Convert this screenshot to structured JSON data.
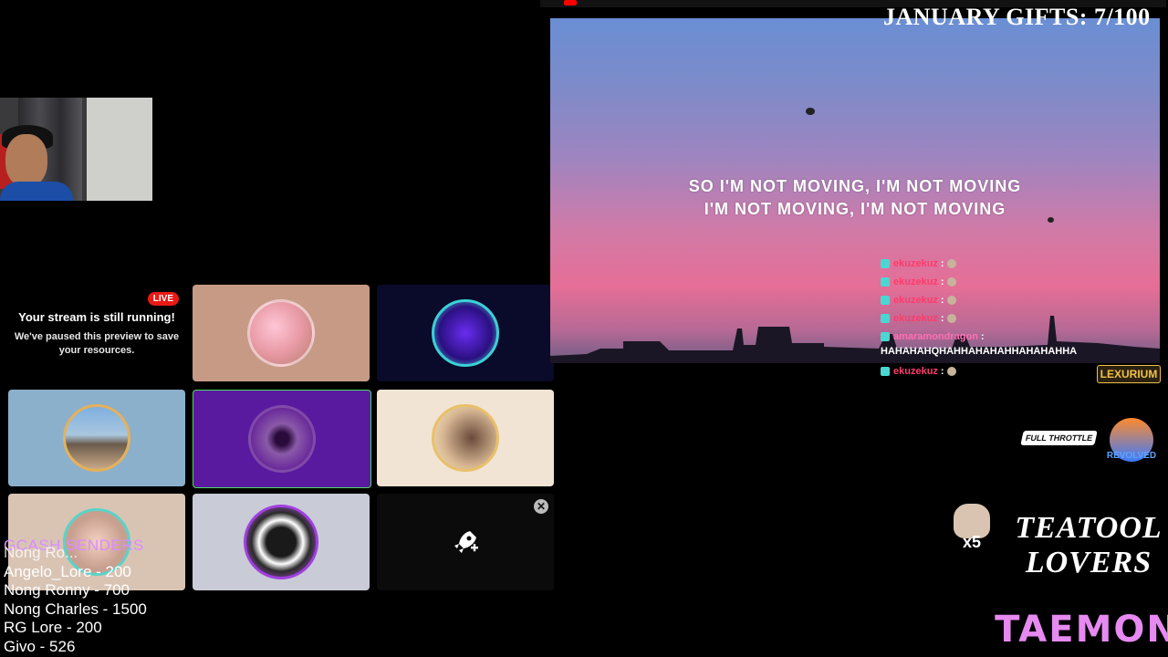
{
  "paused_preview": {
    "live_badge": "LIVE",
    "title": "Your stream is still running!",
    "description": "We've paused this preview to save your resources."
  },
  "sources": {
    "add_icon": "rocket-plus-icon",
    "close_icon": "close-icon"
  },
  "gifts_counter": "JANUARY GIFTS: 7/100",
  "video": {
    "lyrics_line1": "SO I'M NOT MOVING, I'M NOT MOVING",
    "lyrics_line2": "I'M NOT MOVING, I'M NOT MOVING"
  },
  "chat": {
    "messages": [
      {
        "user": "ekuzekuz",
        "text": ""
      },
      {
        "user": "ekuzekuz",
        "text": ""
      },
      {
        "user": "ekuzekuz",
        "text": ""
      },
      {
        "user": "ekuzekuz",
        "text": ""
      },
      {
        "user": "amaramondragon",
        "text": "HAHAHAHQHAHHAHAHAHHAHAHAHHA"
      },
      {
        "user": "ekuzekuz",
        "text": ""
      }
    ]
  },
  "senders": {
    "title": "GCASH SENDERS",
    "list": [
      "Nong Ro...",
      "Angelo_Lore - 200",
      "Nong Ronny - 700",
      "Nong Charles - 1500",
      "RG Lore - 200",
      "Givo - 526"
    ]
  },
  "logos": {
    "lexurium": "LEXURIUM",
    "full_throttle": "FULL THROTTLE",
    "revolved": "REVOLVED",
    "cat_multiplier": "x5",
    "teatool_line1": "TEATOOL",
    "teatool_line2": "LOVERS",
    "taemon": "TAEMON"
  },
  "colors": {
    "live": "#e91916",
    "senders_title": "#d98cff",
    "chat_user": "#ff3b6b",
    "taemon": "#e68af0"
  }
}
